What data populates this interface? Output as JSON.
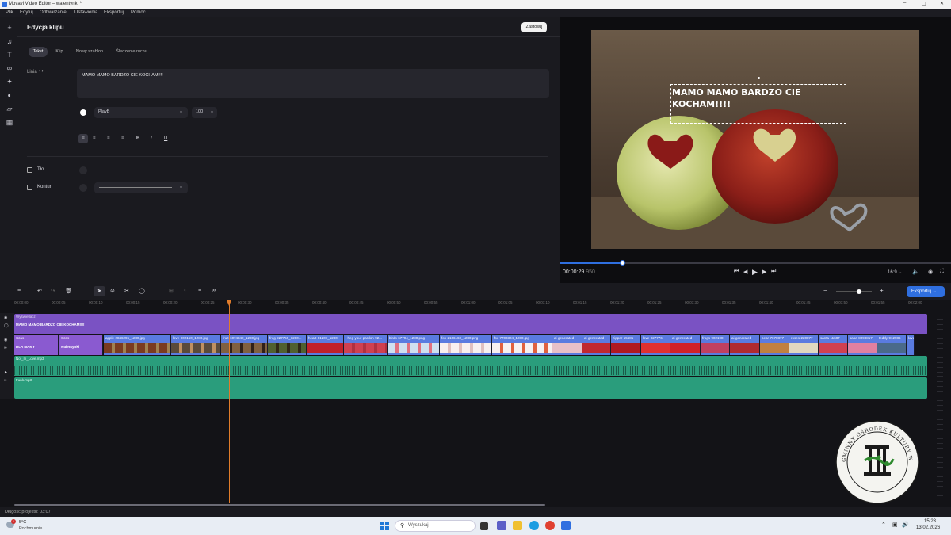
{
  "window": {
    "title": "Movavi Video Editor – walentynki *",
    "controls": [
      "–",
      "▢",
      "✕"
    ]
  },
  "menu": [
    "Plik",
    "Edytuj",
    "Odtwarzanie",
    "Ustawienia",
    "Eksportuj",
    "Pomoc"
  ],
  "edit": {
    "heading": "Edycja klipu",
    "apply_label": "Zastosuj",
    "tabs": [
      "Tekst",
      "Klip",
      "Nowy szablon",
      "Śledzenie ruchu"
    ],
    "active_tab": 0,
    "line_label": "Linia",
    "text_value": "MAMO MAMO  BARDZO CIE KOCHAM!!!!",
    "font": "PlayB",
    "size": "100",
    "background_label": "Tło",
    "outline_label": "Kontur"
  },
  "preview": {
    "overlay_text": "MAMO MAMO  BARDZO CIE KOCHAM!!!!",
    "time_main": "00:00:29",
    "time_ms": ".950",
    "progress": 0.16,
    "aspect": "16:9"
  },
  "timeline": {
    "export_label": "Eksportuj",
    "ruler": [
      "00:00:00",
      "00:00:05",
      "00:00:10",
      "00:00:15",
      "00:00:20",
      "00:00:25",
      "00:00:30",
      "00:00:35",
      "00:00:40",
      "00:00:45",
      "00:00:50",
      "00:00:55",
      "00:01:00",
      "00:01:05",
      "00:01:10",
      "00:01:15",
      "00:01:20",
      "00:01:25",
      "00:01:30",
      "00:01:35",
      "00:01:40",
      "00:01:45",
      "00:01:50",
      "00:01:55",
      "00:02:00"
    ],
    "title_track": {
      "label": "Wyświetlacz",
      "text": "MAMO MAMO BARDZO CIE KOCHAM!!!!"
    },
    "text_clips": [
      {
        "top": "Czas",
        "bottom": "DLA MAMY"
      },
      {
        "top": "Czas",
        "bottom": "walentynki"
      }
    ],
    "video_clips": [
      "apple-2846296_1280.jpg",
      "love-902150_1280.jpg",
      "fruit-1074840_1280.jpg",
      "frog-927759_1280...",
      "heart-81207_1280",
      "i-heg-your-pardon-92...",
      "birds-67794_1280.png",
      "fox-2166160_1280.png",
      "fox-7700324_1280.jpg",
      "ai-generated",
      "ai-generated",
      "zipper-15681",
      "love-927776",
      "ai-generated",
      "frogs-902198",
      "ai-generated",
      "bear-7670877",
      "roses-220877",
      "santa-11687",
      "saba-8098817",
      "teddy-912986",
      "love"
    ],
    "audio1": "Not_In_Love.mp3",
    "audio2": "Funk.mp3",
    "project_length": "Długość projektu: 03:07"
  },
  "stamp": {
    "text": "GMINNY OŚRODEK KULTURY W STAWIGUDZIE"
  },
  "taskbar": {
    "weather_temp": "5°C",
    "weather_desc": "Pochmurnie",
    "weather_badge": "1",
    "search_placeholder": "Wyszukaj",
    "time": "15:23",
    "date": "13.02.2026"
  },
  "colors": {
    "accent": "#2f6fe0",
    "playhead": "#e07c2a",
    "purple": "#7a52c3",
    "clipblue": "#5a7be0",
    "audio": "#2a9d7c"
  }
}
